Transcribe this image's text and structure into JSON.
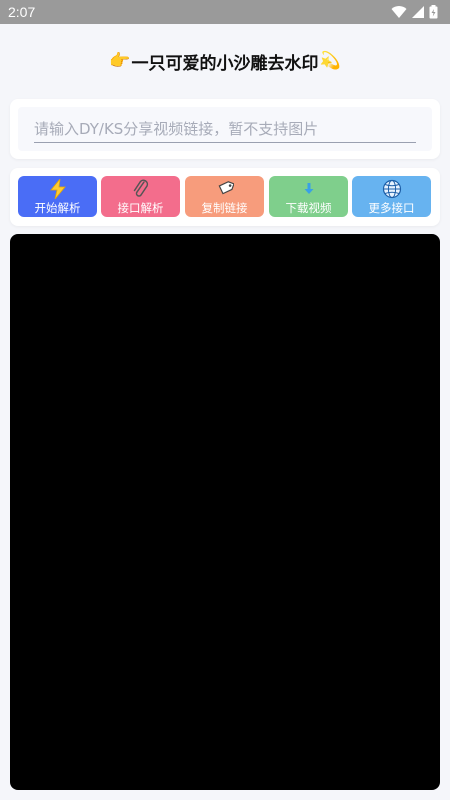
{
  "status_bar": {
    "time": "2:07"
  },
  "app": {
    "title_prefix_emoji": "👉",
    "title": "一只可爱的小沙雕去水印",
    "title_suffix_emoji": "💫"
  },
  "input": {
    "placeholder": "请输入DY/KS分享视频链接，暂不支持图片",
    "value": ""
  },
  "buttons": [
    {
      "label": "开始解析",
      "icon": "lightning-icon",
      "color": "#4a6df6"
    },
    {
      "label": "接口解析",
      "icon": "paperclip-icon",
      "color": "#f36d8c"
    },
    {
      "label": "复制链接",
      "icon": "tag-icon",
      "color": "#f79c7c"
    },
    {
      "label": "下载视频",
      "icon": "down-arrow-icon",
      "color": "#7fcf8c"
    },
    {
      "label": "更多接口",
      "icon": "globe-icon",
      "color": "#67b3f0"
    }
  ]
}
